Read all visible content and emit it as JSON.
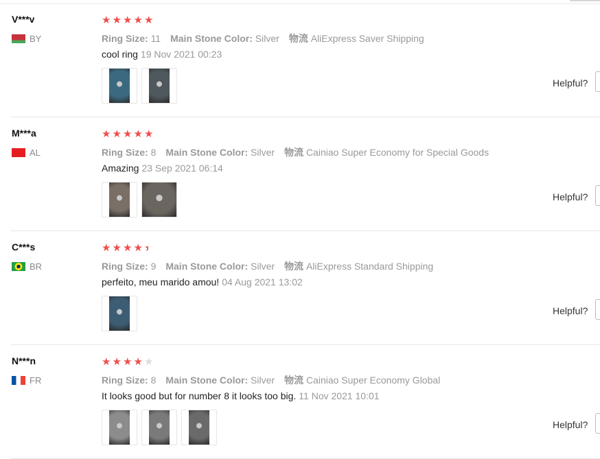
{
  "reviews": [
    {
      "user": "V***v",
      "country": "BY",
      "flag_colors": [
        "#c8313e",
        "#4aa657"
      ],
      "rating": 5,
      "ring_size_label": "Ring Size:",
      "ring_size": "11",
      "stone_label": "Main Stone Color:",
      "stone": "Silver",
      "shipping_label": "物流",
      "shipping": "AliExpress Saver Shipping",
      "text": "cool ring",
      "date": "19 Nov 2021 00:23",
      "photos": [
        {
          "tone": "#3b6a80",
          "wide": false
        },
        {
          "tone": "#4f585c",
          "wide": false
        }
      ],
      "helpful_label": "Helpful?"
    },
    {
      "user": "M***a",
      "country": "AL",
      "flag_colors": [
        "#e41e20",
        "#111111"
      ],
      "rating": 5,
      "ring_size_label": "Ring Size:",
      "ring_size": "8",
      "stone_label": "Main Stone Color:",
      "stone": "Silver",
      "shipping_label": "物流",
      "shipping": "Cainiao Super Economy for Special Goods",
      "text": "Amazing",
      "date": "23 Sep 2021 06:14",
      "photos": [
        {
          "tone": "#7a6f66",
          "wide": false
        },
        {
          "tone": "#6b6560",
          "wide": true
        }
      ],
      "helpful_label": "Helpful?"
    },
    {
      "user": "C***s",
      "country": "BR",
      "flag_colors": [
        "#229e45",
        "#f8e509"
      ],
      "rating": 4.5,
      "ring_size_label": "Ring Size:",
      "ring_size": "9",
      "stone_label": "Main Stone Color:",
      "stone": "Silver",
      "shipping_label": "物流",
      "shipping": "AliExpress Standard Shipping",
      "text": "perfeito, meu marido amou!",
      "date": "04 Aug 2021 13:02",
      "photos": [
        {
          "tone": "#3d5d74",
          "wide": false
        }
      ],
      "helpful_label": "Helpful?"
    },
    {
      "user": "N***n",
      "country": "FR",
      "flag_colors": [
        "#0055a4",
        "#ef4135"
      ],
      "rating": 4,
      "ring_size_label": "Ring Size:",
      "ring_size": "8",
      "stone_label": "Main Stone Color:",
      "stone": "Silver",
      "shipping_label": "物流",
      "shipping": "Cainiao Super Economy Global",
      "text": "It looks good but for number 8 it looks too big.",
      "date": "11 Nov 2021 10:01",
      "photos": [
        {
          "tone": "#8c8c8c",
          "wide": false
        },
        {
          "tone": "#7a7a7a",
          "wide": false
        },
        {
          "tone": "#6a6a6a",
          "wide": false
        }
      ],
      "helpful_label": "Helpful?"
    }
  ]
}
